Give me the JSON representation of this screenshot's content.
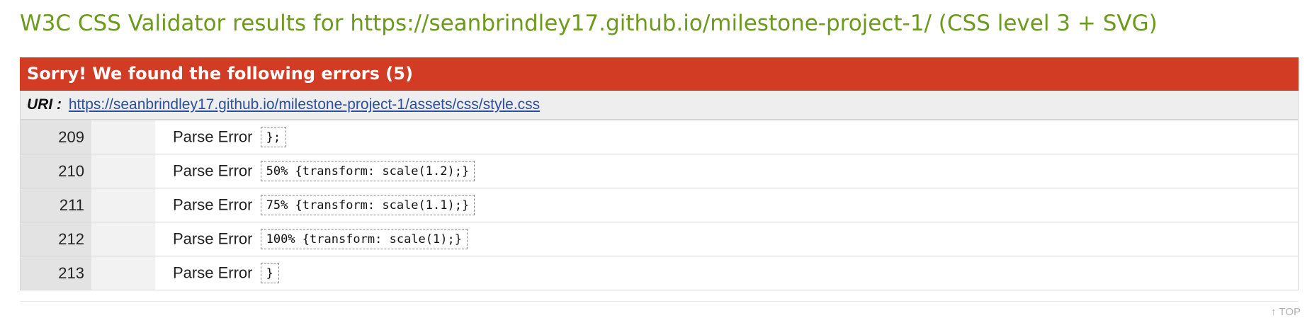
{
  "page": {
    "title": "W3C CSS Validator results for https://seanbrindley17.github.io/milestone-project-1/ (CSS level 3 + SVG)"
  },
  "results": {
    "error_heading": "Sorry! We found the following errors (5)",
    "uri_label": "URI :",
    "uri": "https://seanbrindley17.github.io/milestone-project-1/assets/css/style.css",
    "errors": [
      {
        "line": "209",
        "type": "Parse Error",
        "code": "};"
      },
      {
        "line": "210",
        "type": "Parse Error",
        "code": "50% {transform: scale(1.2);}"
      },
      {
        "line": "211",
        "type": "Parse Error",
        "code": "75% {transform: scale(1.1);}"
      },
      {
        "line": "212",
        "type": "Parse Error",
        "code": "100% {transform: scale(1);}"
      },
      {
        "line": "213",
        "type": "Parse Error",
        "code": "}"
      }
    ]
  },
  "footer": {
    "top_link": "↑ TOP"
  },
  "colors": {
    "title": "#6b9a1c",
    "error_banner": "#d33c24",
    "link": "#2b4f9a"
  }
}
